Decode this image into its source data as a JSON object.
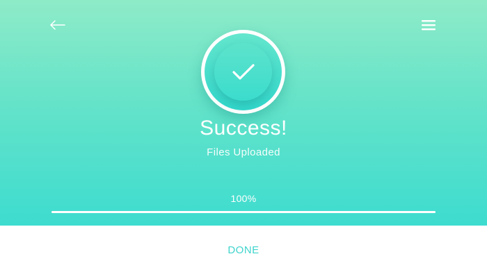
{
  "header": {
    "back_icon": "arrow-left-icon",
    "menu_icon": "hamburger-menu-icon"
  },
  "status": {
    "icon": "checkmark-icon",
    "title": "Success!",
    "subtitle": "Files Uploaded"
  },
  "progress": {
    "label": "100%",
    "value": 1.0
  },
  "footer": {
    "done_label": "DONE"
  },
  "colors": {
    "gradient_top": "#8eebc8",
    "gradient_bottom": "#3ddccf",
    "accent": "#3fd4cc",
    "text_on_gradient": "#ffffff"
  }
}
